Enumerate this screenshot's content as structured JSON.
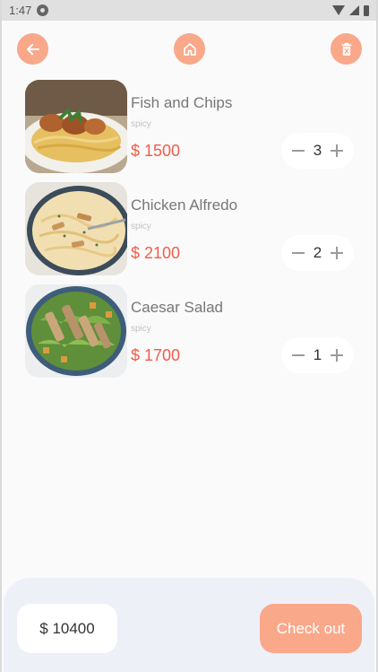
{
  "status_bar": {
    "time": "1:47"
  },
  "header": {
    "back_icon": "arrow-left-icon",
    "home_icon": "home-icon",
    "clear_icon": "trash-icon"
  },
  "cart": {
    "items": [
      {
        "name": "Fish and Chips",
        "tag": "spicy",
        "price": "$ 1500",
        "qty": "3",
        "image": "shrimp-pasta"
      },
      {
        "name": "Chicken Alfredo",
        "tag": "spicy",
        "price": "$ 2100",
        "qty": "2",
        "image": "chicken-alfredo"
      },
      {
        "name": "Caesar Salad",
        "tag": "spicy",
        "price": "$ 1700",
        "qty": "1",
        "image": "caesar-salad"
      }
    ]
  },
  "footer": {
    "total": "$ 10400",
    "checkout_label": "Check out"
  },
  "colors": {
    "accent": "#f9a88a",
    "price": "#f25c4a",
    "panel": "#eef0f8"
  }
}
